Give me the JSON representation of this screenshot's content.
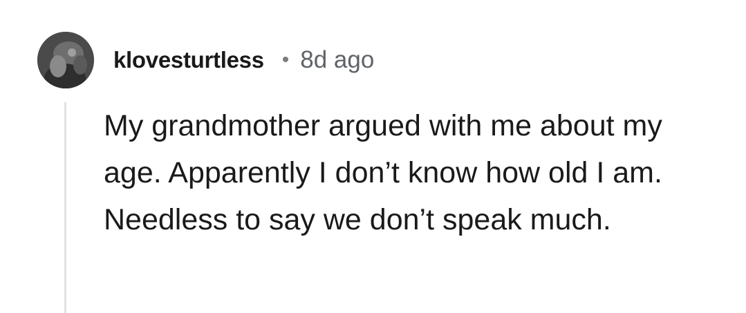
{
  "comment": {
    "username": "klovesturtless",
    "separator": "•",
    "timestamp": "8d ago",
    "avatar_icon": "user-avatar-icon",
    "text": "My grandmother argued with me about my age. Apparently I don’t know how old I am. Needless to say we don’t speak much."
  },
  "colors": {
    "text": "#1a1a1b",
    "meta": "#5f6368",
    "thread_line": "#e1e1e1"
  }
}
